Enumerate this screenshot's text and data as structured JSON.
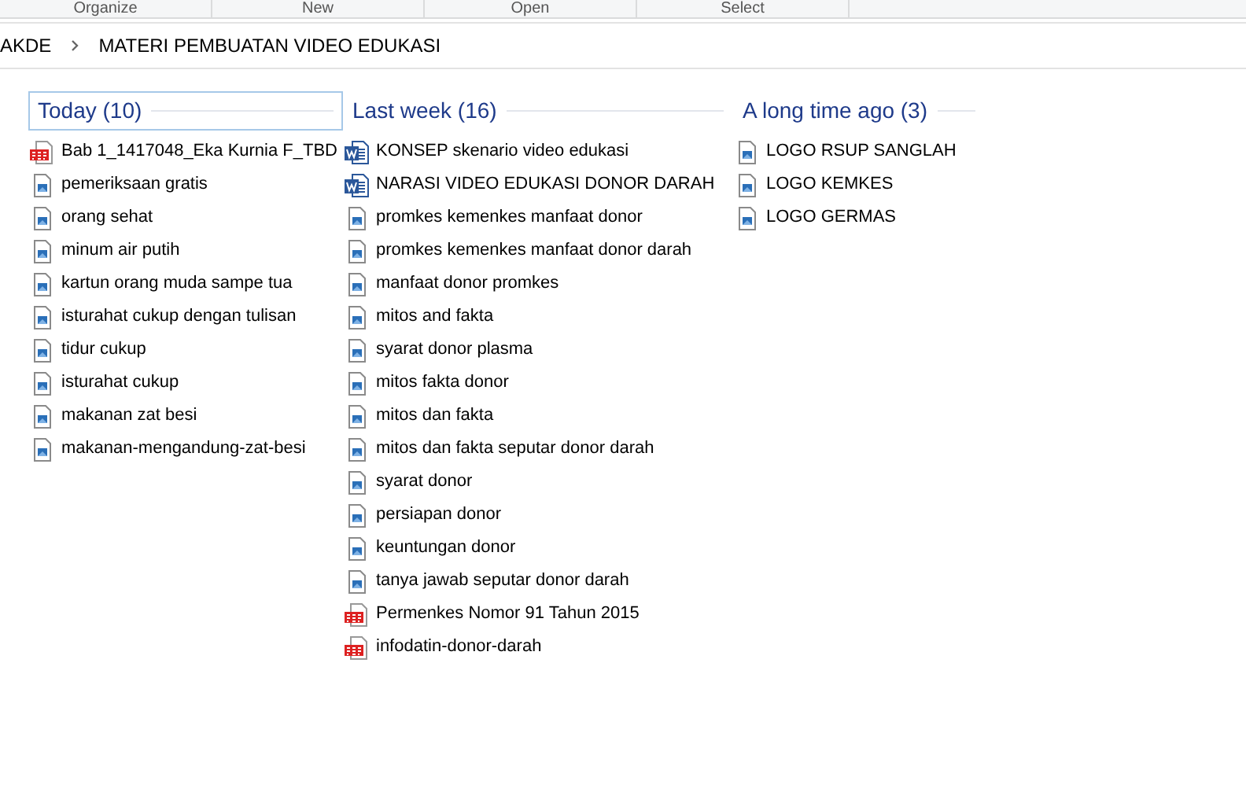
{
  "ribbon": {
    "groups": [
      "Organize",
      "New",
      "Open",
      "Select"
    ]
  },
  "breadcrumb": [
    "AKDE",
    "MATERI PEMBUATAN VIDEO EDUKASI"
  ],
  "groups": [
    {
      "title": "Today (10)",
      "selected": true,
      "items": [
        {
          "name": "Bab 1_1417048_Eka Kurnia F_TBD",
          "kind": "pdf"
        },
        {
          "name": "pemeriksaan gratis",
          "kind": "image"
        },
        {
          "name": "orang sehat",
          "kind": "image"
        },
        {
          "name": "minum air putih",
          "kind": "image"
        },
        {
          "name": "kartun orang muda sampe tua",
          "kind": "image"
        },
        {
          "name": "isturahat cukup dengan tulisan",
          "kind": "image"
        },
        {
          "name": "tidur cukup",
          "kind": "image"
        },
        {
          "name": "isturahat cukup",
          "kind": "image"
        },
        {
          "name": "makanan zat besi",
          "kind": "image"
        },
        {
          "name": "makanan-mengandung-zat-besi",
          "kind": "image"
        }
      ]
    },
    {
      "title": "Last week (16)",
      "selected": false,
      "items": [
        {
          "name": "KONSEP skenario video edukasi",
          "kind": "word"
        },
        {
          "name": "NARASI VIDEO EDUKASI DONOR DARAH",
          "kind": "word"
        },
        {
          "name": "promkes kemenkes manfaat donor",
          "kind": "image"
        },
        {
          "name": "promkes kemenkes manfaat donor darah",
          "kind": "image"
        },
        {
          "name": "manfaat donor promkes",
          "kind": "image"
        },
        {
          "name": "mitos and fakta",
          "kind": "image"
        },
        {
          "name": "syarat donor plasma",
          "kind": "image"
        },
        {
          "name": "mitos fakta donor",
          "kind": "image"
        },
        {
          "name": "mitos dan fakta",
          "kind": "image"
        },
        {
          "name": "mitos dan fakta seputar donor darah",
          "kind": "image"
        },
        {
          "name": "syarat donor",
          "kind": "image"
        },
        {
          "name": "persiapan donor",
          "kind": "image"
        },
        {
          "name": "keuntungan donor",
          "kind": "image"
        },
        {
          "name": "tanya jawab seputar donor darah",
          "kind": "image"
        },
        {
          "name": "Permenkes Nomor 91 Tahun 2015",
          "kind": "pdf"
        },
        {
          "name": "infodatin-donor-darah",
          "kind": "pdf"
        }
      ]
    },
    {
      "title": "A long time ago (3)",
      "selected": false,
      "items": [
        {
          "name": "LOGO RSUP SANGLAH",
          "kind": "image"
        },
        {
          "name": "LOGO KEMKES",
          "kind": "image"
        },
        {
          "name": "LOGO GERMAS",
          "kind": "image"
        }
      ]
    }
  ]
}
